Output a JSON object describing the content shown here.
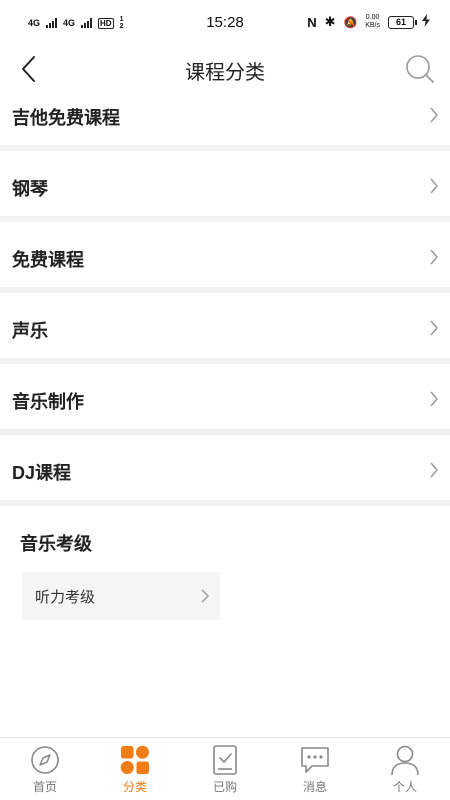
{
  "status_bar": {
    "signal1": "4G",
    "signal2": "4G",
    "hd": "HD",
    "hd_sub": "1 2",
    "time": "15:28",
    "nfc": "N",
    "bluetooth": "✱",
    "mute": "🔕",
    "speed_value": "0.00",
    "speed_unit": "KB/s",
    "battery": "61"
  },
  "header": {
    "title": "课程分类"
  },
  "categories": [
    {
      "label": "吉他免费课程"
    },
    {
      "label": "钢琴"
    },
    {
      "label": "免费课程"
    },
    {
      "label": "声乐"
    },
    {
      "label": "音乐制作"
    },
    {
      "label": "DJ课程"
    }
  ],
  "section": {
    "title": "音乐考级",
    "items": [
      {
        "label": "听力考级"
      }
    ]
  },
  "tab_bar": {
    "active_color": "#f07c16",
    "tabs": [
      {
        "label": "首页",
        "icon": "compass-icon"
      },
      {
        "label": "分类",
        "icon": "grid-icon"
      },
      {
        "label": "已购",
        "icon": "purchased-icon"
      },
      {
        "label": "消息",
        "icon": "message-icon"
      },
      {
        "label": "个人",
        "icon": "user-icon"
      }
    ]
  }
}
